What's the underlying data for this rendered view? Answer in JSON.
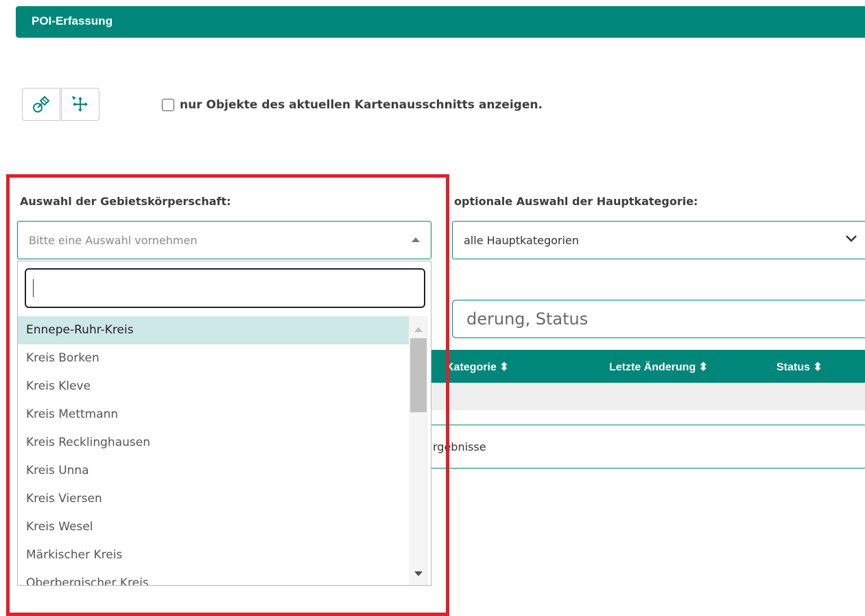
{
  "header": {
    "title": "POI-Erfassung"
  },
  "toolbar": {
    "tool1_icon": "satellite-icon",
    "tool2_icon": "move-arrows-icon",
    "checkbox_label": "nur Objekte des aktuellen Kartenausschnitts anzeigen.",
    "checkbox_checked": false
  },
  "filters": {
    "region_label": "Auswahl der Gebietskörperschaft:",
    "region_placeholder": "Bitte eine Auswahl vornehmen",
    "category_label": "optionale Auswahl der Hauptkategorie:",
    "category_value": "alle Hauptkategorien"
  },
  "dropdown": {
    "search_value": "",
    "items": [
      "Ennepe-Ruhr-Kreis",
      "Kreis Borken",
      "Kreis Kleve",
      "Kreis Mettmann",
      "Kreis Recklinghausen",
      "Kreis Unna",
      "Kreis Viersen",
      "Kreis Wesel",
      "Märkischer Kreis",
      "Oberbergischer Kreis"
    ],
    "highlighted_index": 0
  },
  "search": {
    "placeholder_partial": "derung, Status"
  },
  "table": {
    "columns": [
      "Kategorie",
      "Letzte Änderung",
      "Status"
    ]
  },
  "results": {
    "text_partial": "rgebnisse"
  },
  "colors": {
    "accent": "#00877a",
    "highlight": "#cde8e6",
    "annotation": "#e0202a"
  }
}
